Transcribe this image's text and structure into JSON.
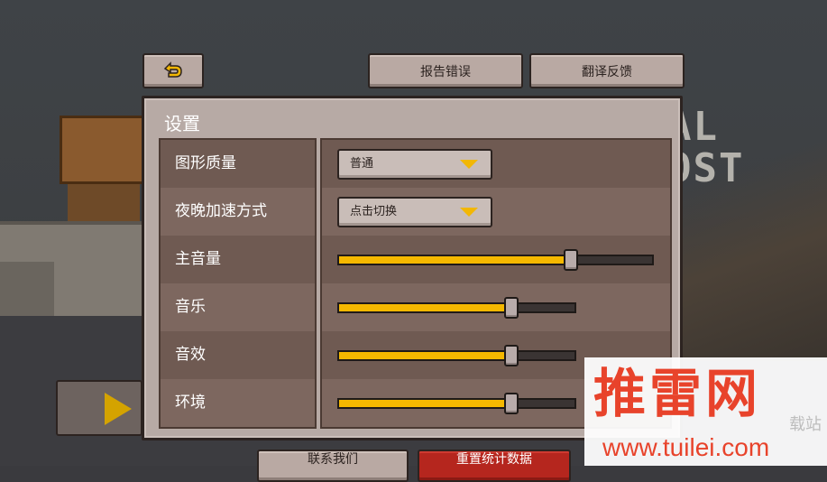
{
  "background": {
    "logo_lines": [
      "AL",
      "OST"
    ]
  },
  "top_bar": {
    "back_icon": "undo-arrow-icon",
    "report_label": "报告错误",
    "translate_label": "翻译反馈"
  },
  "settings": {
    "title": "设置",
    "rows": [
      {
        "label": "图形质量",
        "control": "dropdown",
        "value": "普通"
      },
      {
        "label": "夜晚加速方式",
        "control": "dropdown",
        "value": "点击切换"
      },
      {
        "label": "主音量",
        "control": "slider",
        "level": 0.74
      },
      {
        "label": "音乐",
        "control": "slider",
        "level": 0.73
      },
      {
        "label": "音效",
        "control": "slider",
        "level": 0.73
      },
      {
        "label": "环境",
        "control": "slider",
        "level": 0.73
      }
    ]
  },
  "side": {
    "play_icon": "play-triangle-icon"
  },
  "bottom_bar": {
    "contact_label": "联系我们",
    "reset_label": "重置统计数据"
  },
  "watermark": {
    "brand": "推雷网",
    "url": "www.tuilei.com",
    "side_text": "载站"
  },
  "colors": {
    "accent_yellow": "#f5b800",
    "panel": "#b7aaa5",
    "reset_red": "#b5261e",
    "watermark_red": "#e8432b"
  }
}
